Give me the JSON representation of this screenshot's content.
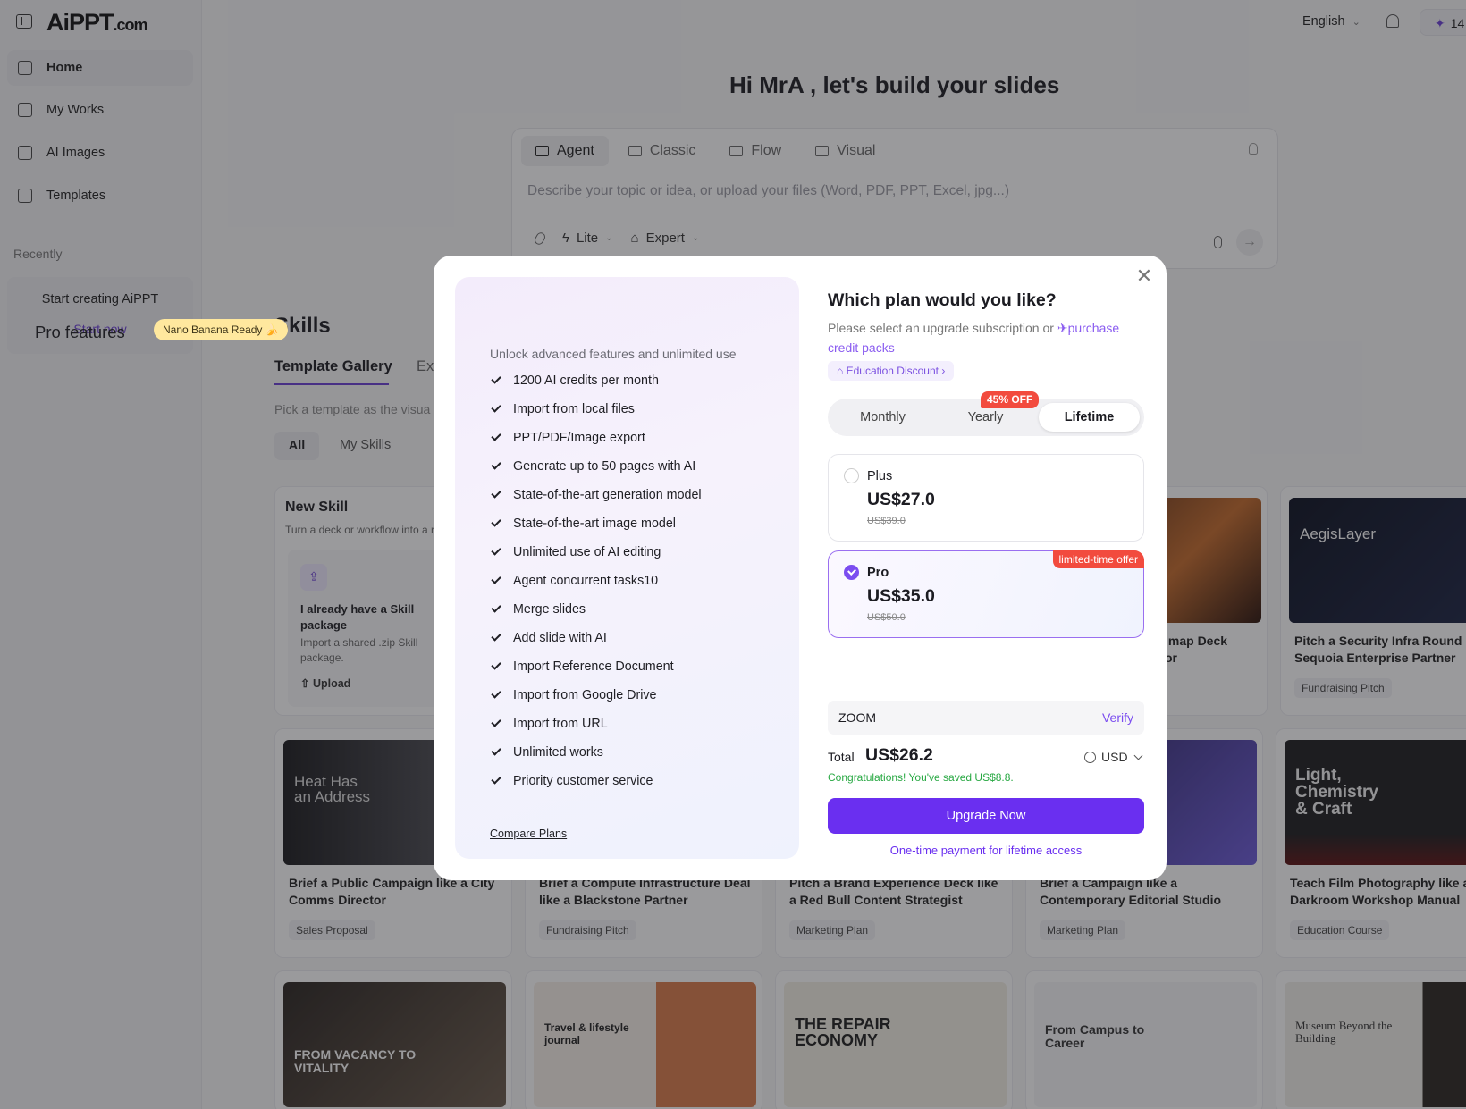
{
  "app": {
    "logo": "AiPPT",
    "logo_suffix": ".com",
    "language": "English",
    "credits": "14"
  },
  "sidebar": {
    "items": [
      {
        "label": "Home",
        "icon": "home-icon"
      },
      {
        "label": "My Works",
        "icon": "folder-icon"
      },
      {
        "label": "AI Images",
        "icon": "image-icon"
      },
      {
        "label": "Templates",
        "icon": "template-icon"
      }
    ],
    "recently_label": "Recently",
    "recent_card": {
      "title": "Start creating AiPPT",
      "cta": "Start now"
    }
  },
  "main": {
    "greeting": "Hi MrA , let's build your slides",
    "composer": {
      "tabs": [
        "Agent",
        "Classic",
        "Flow",
        "Visual"
      ],
      "placeholder": "Describe your topic or idea, or upload your files (Word, PDF, PPT, Excel, jpg...)",
      "lite_label": "Lite",
      "expert_label": "Expert"
    },
    "skills_title": "Skills",
    "gallery_tab": "Template Gallery",
    "gallery_tab2": "Ex",
    "pick_text": "Pick a template as the visua",
    "filters": {
      "all": "All",
      "my": "My Skills"
    },
    "new_skill": {
      "title": "New Skill",
      "subtitle": "Turn a deck or workflow into a r",
      "heading": "I already have a Skill package",
      "description": "Import a shared .zip Skill package.",
      "upload": "Upload"
    },
    "cards_row1": [
      {
        "title": "lmap Deck",
        "title2": "or",
        "tag": ""
      },
      {
        "title": "Pitch a Security Infra Round l",
        "title2": "Sequoia Enterprise Partner",
        "tag": "Fundraising Pitch",
        "thumb": "AegisLayer"
      }
    ],
    "cards_row2": [
      {
        "title": "Brief a Public Campaign like a City Comms Director",
        "tag": "Sales Proposal",
        "thumb": "Heat Has an Address"
      },
      {
        "title": "Brief a Compute Infrastructure Deal like a Blackstone Partner",
        "tag": "Fundraising Pitch",
        "thumb": ""
      },
      {
        "title": "Pitch a Brand Experience Deck like a Red Bull Content Strategist",
        "tag": "Marketing Plan",
        "thumb": ""
      },
      {
        "title": "Brief a Campaign like a Contemporary Editorial Studio",
        "tag": "Marketing Plan",
        "thumb": ""
      },
      {
        "title": "Teach Film Photography like a Darkroom Workshop Manual",
        "tag": "Education Course",
        "thumb": "Light, Chemistry & Craft"
      }
    ],
    "cards_row3": [
      {
        "thumb": "FROM VACANCY TO VITALITY"
      },
      {
        "thumb": "Travel & lifestyle journal"
      },
      {
        "thumb": "THE REPAIR ECONOMY"
      },
      {
        "thumb": "From Campus to Career"
      },
      {
        "thumb": "Museum Beyond the Building"
      }
    ]
  },
  "modal": {
    "features": {
      "title": "Pro features",
      "badge": "Nano Banana Ready",
      "subtitle": "Unlock advanced features and unlimited use",
      "items": [
        "1200 AI credits per month",
        "Import from local files",
        "PPT/PDF/Image export",
        "Generate up to 50 pages with AI",
        "State-of-the-art generation model",
        "State-of-the-art image model",
        "Unlimited use of AI editing",
        "Agent concurrent tasks10",
        "Merge slides",
        "Add slide with AI",
        "Import Reference Document",
        "Import from Google Drive",
        "Import from URL",
        "Unlimited works",
        "Priority customer service"
      ],
      "compare_link": "Compare Plans"
    },
    "plans": {
      "title": "Which plan would you like?",
      "description": "Please select an upgrade subscription or",
      "purchase_link": "purchase credit packs",
      "education_chip": "Education Discount",
      "periods": [
        "Monthly",
        "Yearly",
        "Lifetime"
      ],
      "selected_period": "Lifetime",
      "yearly_badge": "45% OFF",
      "options": [
        {
          "name": "Plus",
          "price": "US$27.0",
          "old_price": "US$39.0",
          "selected": false
        },
        {
          "name": "Pro",
          "price": "US$35.0",
          "old_price": "US$50.0",
          "selected": true,
          "badge": "limited-time offer"
        }
      ]
    },
    "coupon": {
      "value": "ZOOM",
      "verify_label": "Verify"
    },
    "total": {
      "label": "Total",
      "value": "US$26.2",
      "currency": "USD"
    },
    "saved_text": "Congratulations! You've saved US$8.8.",
    "upgrade_button": "Upgrade Now",
    "note": "One-time payment for lifetime access"
  }
}
